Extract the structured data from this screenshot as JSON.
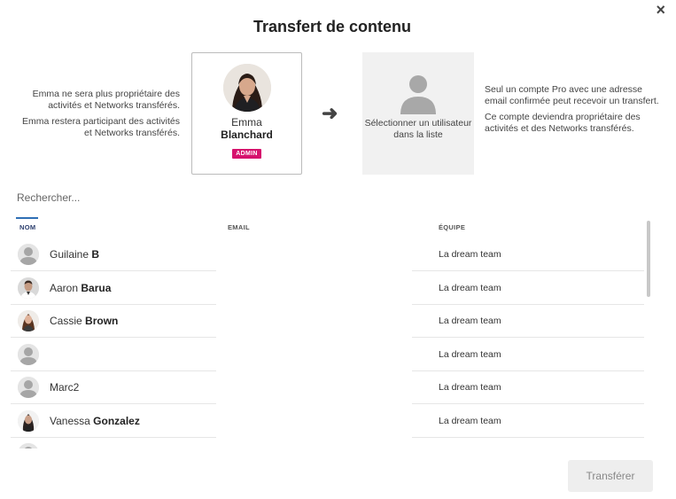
{
  "dialog": {
    "title": "Transfert de contenu",
    "close_label": "×"
  },
  "source": {
    "info_line1": "Emma ne sera plus propriétaire des activités et Networks transférés.",
    "info_line2": "Emma restera participant des activités et Networks transférés.",
    "first_name": "Emma",
    "last_name": "Blanchard",
    "badge": "ADMIN"
  },
  "arrow": "➜",
  "target": {
    "placeholder": "Sélectionner un utilisateur dans la liste",
    "info_line1": "Seul un compte Pro avec une adresse email confirmée peut recevoir un transfert.",
    "info_line2": "Ce compte deviendra propriétaire des activités et des Networks transférés."
  },
  "search": {
    "placeholder": "Rechercher..."
  },
  "table": {
    "headers": {
      "name": "NOM",
      "email": "EMAIL",
      "team": "ÉQUIPE"
    },
    "rows": [
      {
        "first": "Guilaine",
        "last": "B",
        "email": "",
        "team": "La dream team",
        "avatar": "default"
      },
      {
        "first": "Aaron",
        "last": "Barua",
        "email": "",
        "team": "La dream team",
        "avatar": "photo-man"
      },
      {
        "first": "Cassie",
        "last": "Brown",
        "email": "",
        "team": "La dream team",
        "avatar": "photo-woman"
      },
      {
        "first": "",
        "last": "",
        "email": "",
        "team": "La dream team",
        "avatar": "default"
      },
      {
        "first": "Marc2",
        "last": "",
        "email": "",
        "team": "La dream team",
        "avatar": "default"
      },
      {
        "first": "Vanessa",
        "last": "Gonzalez",
        "email": "",
        "team": "La dream team",
        "avatar": "photo-woman-dark"
      }
    ]
  },
  "footer": {
    "transfer_label": "Transférer"
  },
  "colors": {
    "badge": "#d6126d",
    "accent_line": "#2f6fb5",
    "button_bg": "#eeeeee"
  }
}
